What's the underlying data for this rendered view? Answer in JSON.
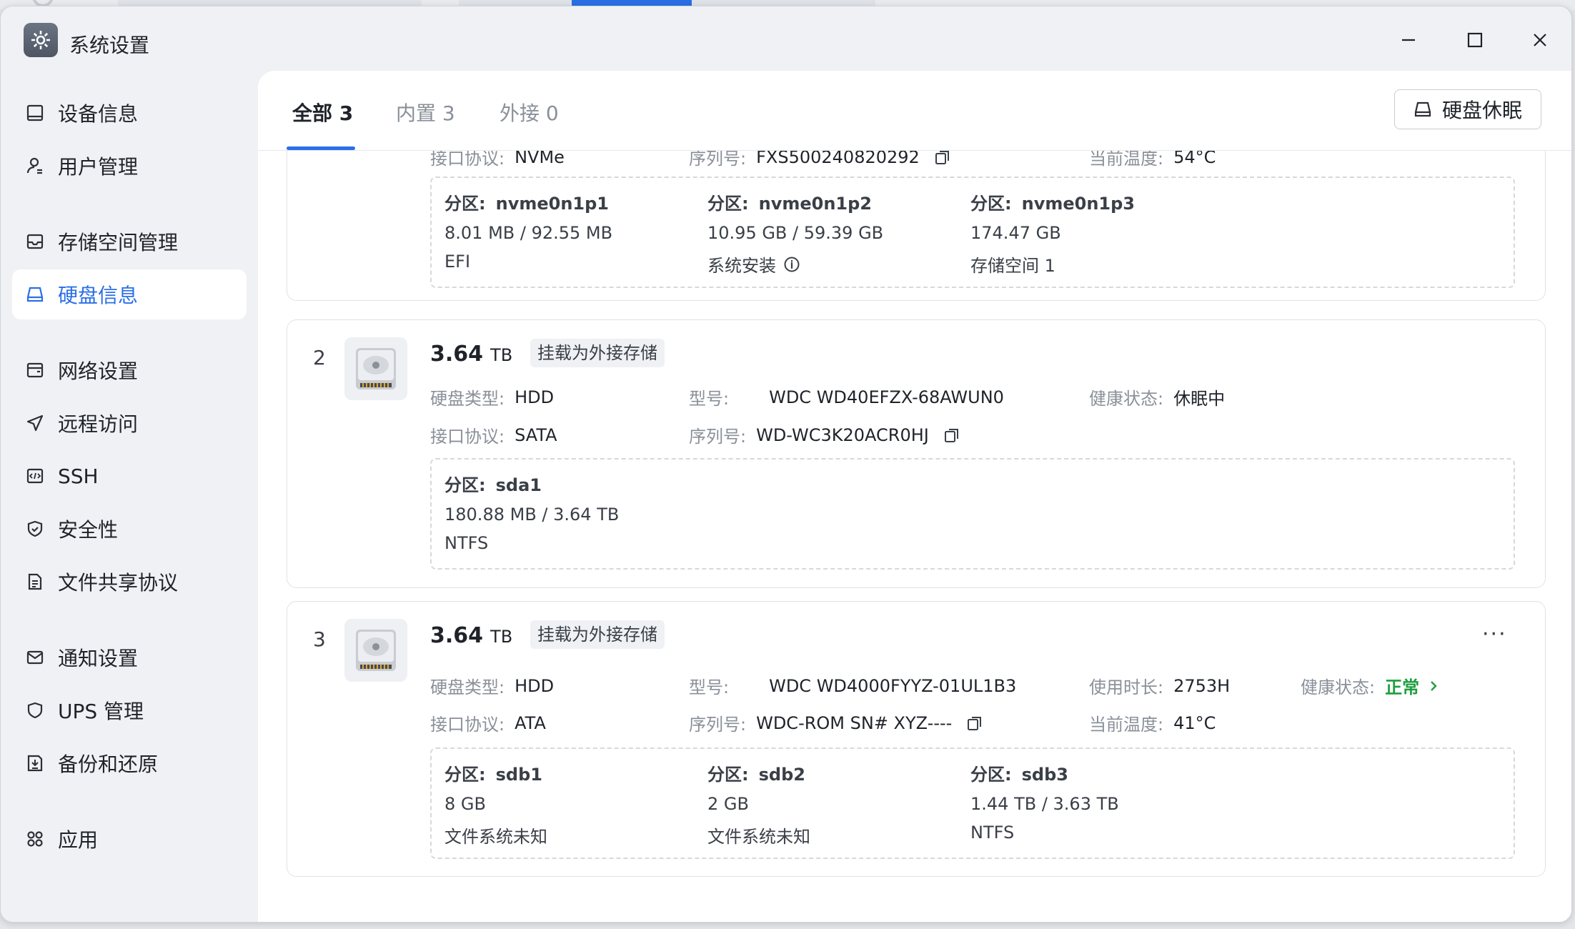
{
  "window": {
    "title": "系统设置"
  },
  "sidebar": {
    "items": [
      {
        "label": "设备信息",
        "icon": "device-info-icon",
        "active": false
      },
      {
        "label": "用户管理",
        "icon": "user-icon",
        "active": false
      },
      {
        "label": "存储空间管理",
        "icon": "storage-icon",
        "active": false
      },
      {
        "label": "硬盘信息",
        "icon": "disk-icon",
        "active": true
      },
      {
        "label": "网络设置",
        "icon": "network-icon",
        "active": false
      },
      {
        "label": "远程访问",
        "icon": "send-icon",
        "active": false
      },
      {
        "label": "SSH",
        "icon": "code-icon",
        "active": false
      },
      {
        "label": "安全性",
        "icon": "shield-check-icon",
        "active": false
      },
      {
        "label": "文件共享协议",
        "icon": "document-icon",
        "active": false
      },
      {
        "label": "通知设置",
        "icon": "mail-icon",
        "active": false
      },
      {
        "label": "UPS 管理",
        "icon": "shield-icon",
        "active": false
      },
      {
        "label": "备份和还原",
        "icon": "backup-icon",
        "active": false
      },
      {
        "label": "应用",
        "icon": "apps-icon",
        "active": false
      }
    ]
  },
  "tabs": [
    {
      "label": "全部 3",
      "active": true
    },
    {
      "label": "内置 3",
      "active": false
    },
    {
      "label": "外接 0",
      "active": false
    }
  ],
  "toolbar": {
    "sleep_label": "硬盘休眠"
  },
  "labels": {
    "interface": "接口协议:",
    "serial": "序列号:",
    "temperature": "当前温度:",
    "disk_type": "硬盘类型:",
    "model": "型号:",
    "health": "健康状态:",
    "usage": "使用时长:",
    "partition": "分区:",
    "mount_tag": "挂载为外接存储"
  },
  "disk1": {
    "interface": "NVMe",
    "serial": "FXS500240820292",
    "temperature": "54°C",
    "partitions": [
      {
        "name": "nvme0n1p1",
        "size": "8.01 MB / 92.55 MB",
        "fs": "EFI"
      },
      {
        "name": "nvme0n1p2",
        "size": "10.95 GB / 59.39 GB",
        "fs": "系统安装"
      },
      {
        "name": "nvme0n1p3",
        "size": "174.47 GB",
        "fs": "存储空间 1"
      }
    ]
  },
  "disk2": {
    "index": "2",
    "capacity": "3.64",
    "unit": "TB",
    "disk_type": "HDD",
    "model": "WDC WD40EFZX-68AWUN0",
    "health": "休眠中",
    "interface": "SATA",
    "serial": "WD-WC3K20ACR0HJ",
    "partitions": [
      {
        "name": "sda1",
        "size": "180.88 MB / 3.64 TB",
        "fs": "NTFS"
      }
    ]
  },
  "disk3": {
    "index": "3",
    "capacity": "3.64",
    "unit": "TB",
    "disk_type": "HDD",
    "model": "WDC WD4000FYYZ-01UL1B3",
    "usage": "2753H",
    "health": "正常",
    "interface": "ATA",
    "serial": "WDC-ROM SN# XYZ----",
    "temperature": "41°C",
    "more": "···",
    "partitions": [
      {
        "name": "sdb1",
        "size": "8 GB",
        "fs": "文件系统未知"
      },
      {
        "name": "sdb2",
        "size": "2 GB",
        "fs": "文件系统未知"
      },
      {
        "name": "sdb3",
        "size": "1.44 TB / 3.63 TB",
        "fs": "NTFS"
      }
    ]
  },
  "colors": {
    "accent": "#2b6fe6",
    "healthy": "#1e9e3e"
  }
}
